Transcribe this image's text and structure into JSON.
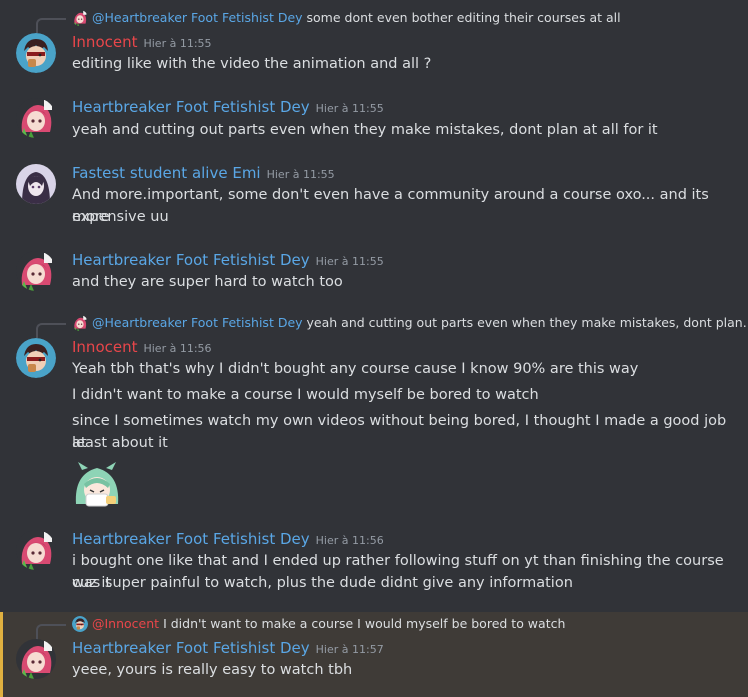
{
  "colors": {
    "dey": "#5aa7e6",
    "innocent": "#e8464a",
    "emi": "#5aa7e6",
    "highlight": "#e0b040"
  },
  "messages": [
    {
      "reply": {
        "mention": "@Heartbreaker Foot Fetishist Dey",
        "text": "some dont even bother editing their courses at all",
        "avatar_icon": "dey-avatar-icon"
      },
      "author": "Innocent",
      "time": "Hier à 11:55",
      "avatar_icon": "innocent-avatar-icon",
      "lines": [
        "editing like with the video the animation and all ?"
      ]
    },
    {
      "author": "Heartbreaker Foot Fetishist Dey",
      "time": "Hier à 11:55",
      "avatar_icon": "dey-avatar-icon",
      "lines": [
        "yeah and cutting out parts even when they make mistakes, dont plan at all for it"
      ]
    },
    {
      "author": "Fastest student alive Emi",
      "time": "Hier à 11:55",
      "avatar_icon": "emi-avatar-icon",
      "lines": [
        "And more.important, some don't even have a community around a course oxo... and its more",
        "expensive uu"
      ]
    },
    {
      "author": "Heartbreaker Foot Fetishist Dey",
      "time": "Hier à 11:55",
      "avatar_icon": "dey-avatar-icon",
      "lines": [
        "and they are super hard to watch too"
      ]
    },
    {
      "reply": {
        "mention": "@Heartbreaker Foot Fetishist Dey",
        "text": "yeah and cutting out parts even when they make mistakes, dont plan...",
        "avatar_icon": "dey-avatar-icon"
      },
      "author": "Innocent",
      "time": "Hier à 11:56",
      "avatar_icon": "innocent-avatar-icon",
      "lines": [
        "Yeah tbh that's why I didn't bought any course cause I know 90% are this way"
      ],
      "followups": [
        "I didn't want to make a course I would myself be bored to watch",
        "since I sometimes watch my own videos without being bored, I thought I made a good job at",
        "least about it"
      ],
      "sticker_icon": "anime-girl-sticker-icon"
    },
    {
      "author": "Heartbreaker Foot Fetishist Dey",
      "time": "Hier à 11:56",
      "avatar_icon": "dey-avatar-icon",
      "lines": [
        "i bought one like that and I ended up rather following stuff on yt than finishing the course cuz it",
        "was super painful to watch, plus the dude didnt give any information"
      ]
    },
    {
      "reply": {
        "mention": "@Innocent",
        "text": "I didn't want to make a course I would myself be bored to watch",
        "avatar_icon": "innocent-avatar-icon"
      },
      "author": "Heartbreaker Foot Fetishist Dey",
      "time": "Hier à 11:57",
      "avatar_icon": "dey-avatar-icon",
      "lines": [
        "yeee, yours is really easy to watch tbh"
      ]
    }
  ]
}
